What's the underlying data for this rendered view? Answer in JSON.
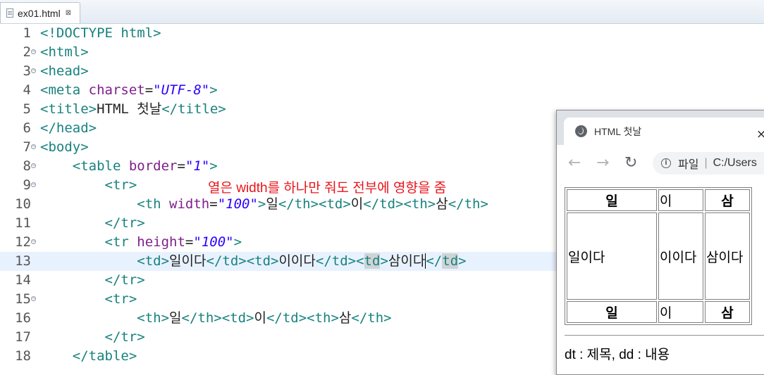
{
  "editor": {
    "tab": {
      "label": "ex01.html",
      "close": "⊠"
    },
    "current_line": 13,
    "comment": "열은 width를 하나만 줘도 전부에 영향을 줌",
    "lines": [
      {
        "n": "1",
        "fold": false
      },
      {
        "n": "2",
        "fold": true
      },
      {
        "n": "3",
        "fold": true
      },
      {
        "n": "4",
        "fold": false
      },
      {
        "n": "5",
        "fold": false
      },
      {
        "n": "6",
        "fold": false
      },
      {
        "n": "7",
        "fold": true
      },
      {
        "n": "8",
        "fold": true
      },
      {
        "n": "9",
        "fold": true
      },
      {
        "n": "10",
        "fold": false
      },
      {
        "n": "11",
        "fold": false
      },
      {
        "n": "12",
        "fold": true
      },
      {
        "n": "13",
        "fold": false
      },
      {
        "n": "14",
        "fold": false
      },
      {
        "n": "15",
        "fold": true
      },
      {
        "n": "16",
        "fold": false
      },
      {
        "n": "17",
        "fold": false
      },
      {
        "n": "18",
        "fold": false
      }
    ],
    "code": {
      "l1": {
        "a": "<!DOCTYPE html>"
      },
      "l2": {
        "a": "<html>"
      },
      "l3": {
        "a": "<head>"
      },
      "l4": {
        "t1": "<meta ",
        "a1": "charset",
        "eq": "=",
        "v1": "\"UTF-8\"",
        "t2": ">"
      },
      "l5": {
        "t1": "<title>",
        "txt": "HTML 첫날",
        "t2": "</title>"
      },
      "l6": {
        "a": "</head>"
      },
      "l7": {
        "a": "<body>"
      },
      "l8": {
        "ind": "    ",
        "t1": "<table ",
        "a1": "border",
        "eq": "=",
        "v1": "\"1\"",
        "t2": ">"
      },
      "l9": {
        "ind": "        ",
        "t1": "<tr>"
      },
      "l10": {
        "ind": "            ",
        "t1": "<th ",
        "a1": "width",
        "eq": "=",
        "v1": "\"100\"",
        "t2": ">",
        "x1": "일",
        "t3": "</th><td>",
        "x2": "이",
        "t4": "</td><th>",
        "x3": "삼",
        "t5": "</th>"
      },
      "l11": {
        "ind": "        ",
        "t1": "</tr>"
      },
      "l12": {
        "ind": "        ",
        "t1": "<tr ",
        "a1": "height",
        "eq": "=",
        "v1": "\"100\"",
        "t2": ">"
      },
      "l13": {
        "ind": "            ",
        "t1": "<td>",
        "x1": "일이다",
        "t2": "</td><td>",
        "x2": "이이다",
        "t3": "</td><",
        "t3b": "td",
        "t3c": ">",
        "x3": "삼이다",
        "t4": "<",
        "t4b": "/",
        "t4c": "td",
        "t4d": ">"
      },
      "l14": {
        "ind": "        ",
        "t1": "</tr>"
      },
      "l15": {
        "ind": "        ",
        "t1": "<tr>"
      },
      "l16": {
        "ind": "            ",
        "t1": "<th>",
        "x1": "일",
        "t2": "</th><td>",
        "x2": "이",
        "t3": "</td><th>",
        "x3": "삼",
        "t4": "</th>"
      },
      "l17": {
        "ind": "        ",
        "t1": "</tr>"
      },
      "l18": {
        "ind": "    ",
        "t1": "</table>"
      }
    }
  },
  "browser": {
    "tab_title": "HTML 첫날",
    "tab_close": "×",
    "nav": {
      "back": "←",
      "forward": "→",
      "reload": "↻"
    },
    "address": {
      "info": "i",
      "label": "파일",
      "separator": "|",
      "url": "C:/Users"
    },
    "table": {
      "row1": [
        "일",
        "이",
        "삼"
      ],
      "row2": [
        "일이다",
        "이이다",
        "삼이다"
      ],
      "row3": [
        "일",
        "이",
        "삼"
      ]
    },
    "dt_text": "dt : 제목, dd : 내용"
  },
  "colors": {
    "tag": "#17827e",
    "attribute": "#7f1f8a",
    "value": "#2a00ff",
    "comment": "#e8151b",
    "current_line": "#e8f2fe"
  }
}
